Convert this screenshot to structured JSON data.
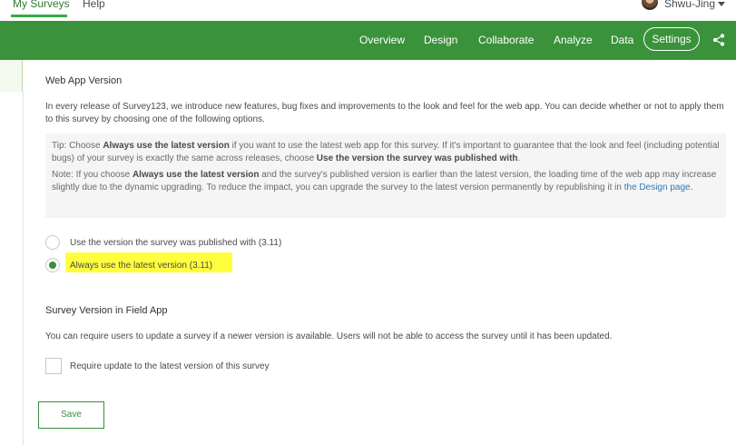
{
  "top_nav": {
    "items": [
      {
        "label": "My Surveys",
        "active": true
      },
      {
        "label": "Help",
        "active": false
      }
    ],
    "user_name": "Shwu-Jing"
  },
  "survey_nav": {
    "items": [
      "Overview",
      "Design",
      "Collaborate",
      "Analyze",
      "Data"
    ],
    "settings_label": "Settings",
    "share_icon": "share-icon"
  },
  "web_app_version": {
    "title": "Web App Version",
    "description": "In every release of Survey123, we introduce new features, bug fixes and improvements to the look and feel for the web app. You can decide whether or not to apply them to this survey by choosing one of the following options.",
    "tip": {
      "t1": "Tip: Choose ",
      "b1": "Always use the latest version",
      "t2": " if you want to use the latest web app for this survey. If it's important to guarantee that the look and feel (including potential bugs) of your survey is exactly the same across releases, choose ",
      "b2": "Use the version the survey was published with",
      "t3": "."
    },
    "note": {
      "t1": "Note: If you choose ",
      "b1": "Always use the latest version",
      "t2": " and the survey's published version is earlier than the latest version, the loading time of the web app may increase slightly due to the dynamic upgrading. To reduce the impact, you can upgrade the survey to the latest version permanently by republishing it in ",
      "link": "the Design page",
      "t3": "."
    },
    "options": [
      {
        "label": "Use the version the survey was published with",
        "version": "(3.11)",
        "selected": false
      },
      {
        "label": "Always use the latest version",
        "version": "(3.11)",
        "selected": true
      }
    ]
  },
  "field_app_version": {
    "title": "Survey Version in Field App",
    "description": "You can require users to update a survey if a newer version is available. Users will not be able to access the survey until it has been updated.",
    "checkbox_label": "Require update to the latest version of this survey",
    "checkbox_checked": false
  },
  "save_label": "Save",
  "colors": {
    "nav_green": "#3a923a",
    "accent_green": "#35913a",
    "highlight_yellow": "#ffff3d",
    "link_blue": "#2f7bb6"
  }
}
